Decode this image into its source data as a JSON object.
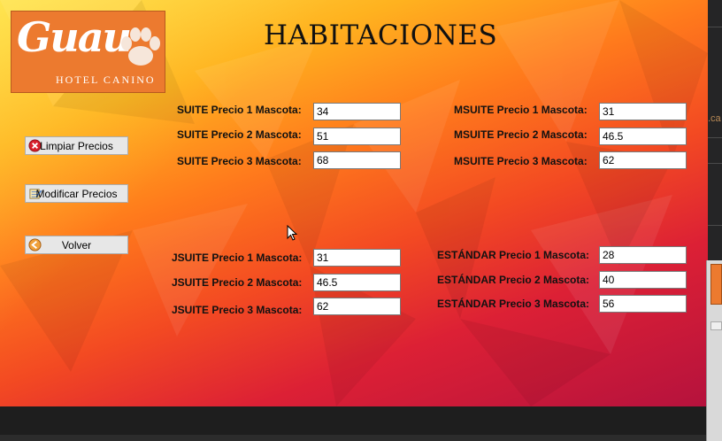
{
  "logo": {
    "script": "Guau",
    "subtitle": "HOTEL CANINO"
  },
  "title": "HABITACIONES",
  "buttons": {
    "limpiar": "Limpiar Precios",
    "modificar": "Modificar Precios",
    "volver": "Volver"
  },
  "groups": {
    "suite": {
      "labels": [
        "SUITE Precio 1 Mascota:",
        "SUITE Precio 2 Mascota:",
        "SUITE Precio 3 Mascota:"
      ],
      "values": [
        "34",
        "51",
        "68"
      ]
    },
    "msuite": {
      "labels": [
        "MSUITE Precio 1 Mascota:",
        "MSUITE Precio 2 Mascota:",
        "MSUITE Precio 3 Mascota:"
      ],
      "values": [
        "31",
        "46.5",
        "62"
      ]
    },
    "jsuite": {
      "labels": [
        "JSUITE Precio 1 Mascota:",
        "JSUITE Precio 2 Mascota:",
        "JSUITE Precio 3 Mascota:"
      ],
      "values": [
        "31",
        "46.5",
        "62"
      ]
    },
    "estandar": {
      "labels": [
        "ESTÁNDAR Precio 1 Mascota:",
        "ESTÁNDAR Precio 2 Mascota:",
        "ESTÁNDAR Precio 3 Mascota:"
      ],
      "values": [
        "28",
        "40",
        "56"
      ]
    }
  },
  "side": {
    "fragment": ".ca"
  },
  "icons": {
    "limpiar": "close-circle-icon",
    "modificar": "edit-document-icon",
    "volver": "back-arrow-icon",
    "logo": "paw-icon"
  },
  "colors": {
    "logo_bg": "#ec7a2f",
    "bg_start": "#ffe14a",
    "bg_end": "#b5123d"
  }
}
